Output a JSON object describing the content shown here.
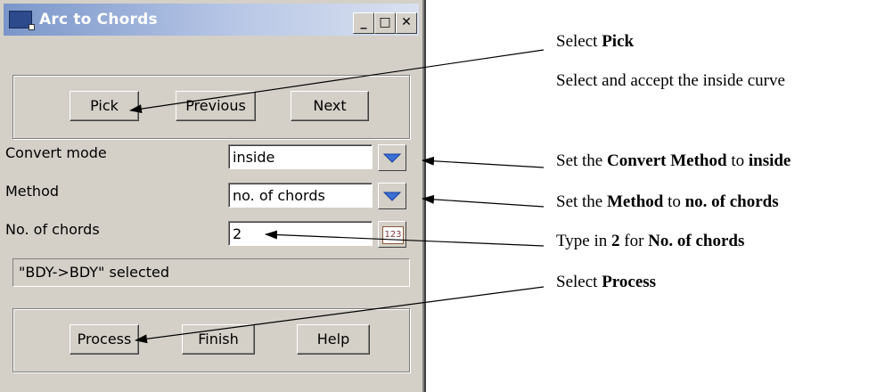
{
  "window": {
    "title": "Arc to Chords",
    "minimize_glyph": "_",
    "maximize_glyph": "□",
    "close_glyph": "✕"
  },
  "top_buttons": {
    "pick": "Pick",
    "previous": "Previous",
    "next": "Next"
  },
  "form": {
    "convert_mode": {
      "label": "Convert mode",
      "value": "inside",
      "icon": "chevron-down-icon"
    },
    "method": {
      "label": "Method",
      "value": "no. of chords",
      "icon": "chevron-down-icon"
    },
    "chords": {
      "label": "No. of chords",
      "value": "2",
      "icon": "numeric-keypad-icon",
      "icon_text": "123"
    }
  },
  "status": "\"BDY->BDY\" selected",
  "bottom_buttons": {
    "process": "Process",
    "finish": "Finish",
    "help": "Help"
  },
  "annotations": {
    "a1": {
      "pre": "Select ",
      "bold": "Pick"
    },
    "a2": {
      "text": "Select and accept the inside curve"
    },
    "a3": {
      "pre": "Set the ",
      "bold1": "Convert Method",
      "mid": " to ",
      "bold2": "inside"
    },
    "a4": {
      "pre": "Set the ",
      "bold1": "Method",
      "mid": " to ",
      "bold2": "no. of chords"
    },
    "a5": {
      "pre": "Type in ",
      "bold1": "2",
      "mid": " for ",
      "bold2": "No. of chords"
    },
    "a6": {
      "pre": "Select ",
      "bold": "Process"
    }
  },
  "colors": {
    "dialog_bg": "#d4d0c8",
    "titlebar": "#7a96c9",
    "dropdown_accent": "#3a6fd8"
  }
}
